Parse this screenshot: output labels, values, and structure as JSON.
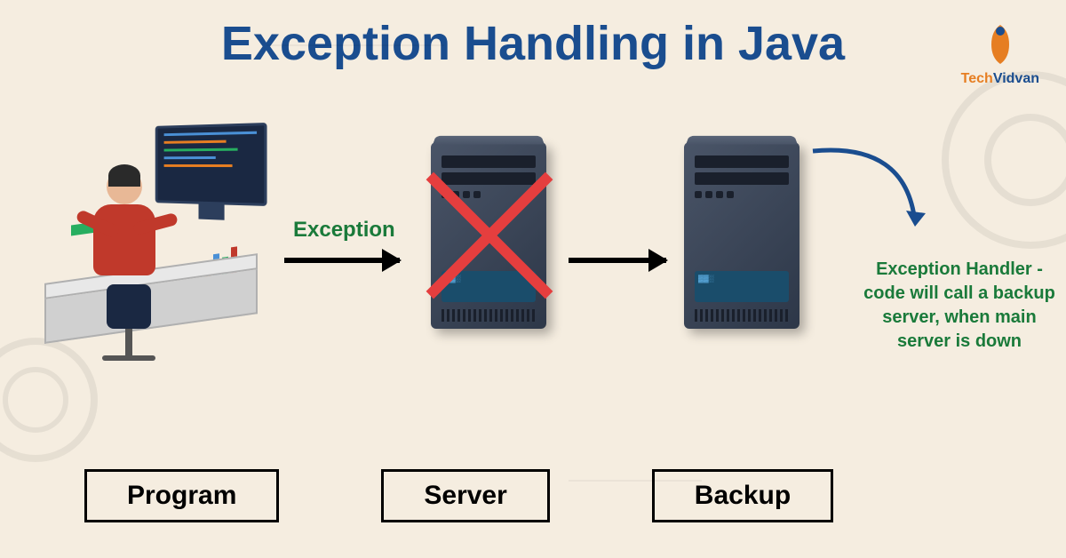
{
  "title": "Exception Handling in Java",
  "logo": {
    "part1": "Tech",
    "part2": "Vidvan"
  },
  "diagram": {
    "exception_label": "Exception",
    "handler_text": "Exception Handler - code will call a backup server, when main server is down",
    "labels": {
      "program": "Program",
      "server": "Server",
      "backup": "Backup"
    }
  }
}
